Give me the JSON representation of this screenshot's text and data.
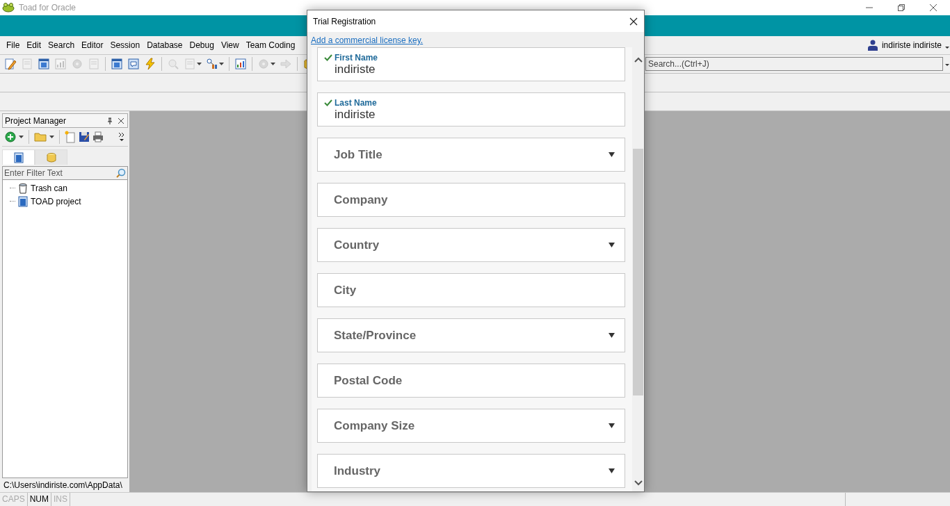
{
  "window": {
    "title": "Toad for Oracle"
  },
  "menu": [
    "File",
    "Edit",
    "Search",
    "Editor",
    "Session",
    "Database",
    "Debug",
    "View",
    "Team Coding"
  ],
  "user": {
    "name": "indiriste indiriste"
  },
  "toolbar": [
    {
      "kind": "pencil",
      "disabled": false,
      "dropdown": false
    },
    {
      "kind": "page",
      "disabled": true,
      "dropdown": false
    },
    {
      "kind": "window",
      "disabled": false,
      "dropdown": false
    },
    {
      "kind": "chart",
      "disabled": true,
      "dropdown": false
    },
    {
      "kind": "gear",
      "disabled": true,
      "dropdown": false
    },
    {
      "kind": "page",
      "disabled": true,
      "dropdown": false
    },
    {
      "kind": "separator"
    },
    {
      "kind": "window",
      "disabled": false,
      "dropdown": false
    },
    {
      "kind": "chat",
      "disabled": false,
      "dropdown": false
    },
    {
      "kind": "bolt",
      "disabled": false,
      "dropdown": false
    },
    {
      "kind": "separator"
    },
    {
      "kind": "magnifier",
      "disabled": true,
      "dropdown": false
    },
    {
      "kind": "page",
      "disabled": true,
      "dropdown": true
    },
    {
      "kind": "network",
      "disabled": false,
      "dropdown": true
    },
    {
      "kind": "separator"
    },
    {
      "kind": "chart",
      "disabled": false,
      "dropdown": false
    },
    {
      "kind": "separator"
    },
    {
      "kind": "gear",
      "disabled": true,
      "dropdown": true
    },
    {
      "kind": "arrow",
      "disabled": true,
      "dropdown": false
    },
    {
      "kind": "separator"
    },
    {
      "kind": "database",
      "disabled": false,
      "dropdown": false
    }
  ],
  "search": {
    "placeholder": "Search...(Ctrl+J)"
  },
  "project_manager": {
    "title": "Project Manager",
    "tabs": [
      {
        "kind": "project",
        "selected": true
      },
      {
        "kind": "database",
        "selected": false
      }
    ],
    "filter": {
      "placeholder": "Enter Filter Text"
    },
    "tree": [
      {
        "label": "Trash can",
        "kind": "trash"
      },
      {
        "label": "TOAD project",
        "kind": "project"
      }
    ],
    "path": "C:\\Users\\indiriste.com\\AppData\\"
  },
  "status_bar": [
    {
      "label": "CAPS",
      "on": false
    },
    {
      "label": "NUM",
      "on": true
    },
    {
      "label": "INS",
      "on": false
    }
  ],
  "dialog": {
    "title": "Trial Registration",
    "link": "Add a commercial license key.",
    "fields": [
      {
        "label": "First Name",
        "value": "indiriste",
        "kind": "text",
        "valid": true
      },
      {
        "label": "Last Name",
        "value": "indiriste",
        "kind": "text",
        "valid": true
      },
      {
        "label": "Job Title",
        "kind": "dropdown",
        "valid": false
      },
      {
        "label": "Company",
        "kind": "text",
        "valid": false
      },
      {
        "label": "Country",
        "kind": "dropdown",
        "valid": false
      },
      {
        "label": "City",
        "kind": "text",
        "valid": false
      },
      {
        "label": "State/Province",
        "kind": "dropdown",
        "valid": false
      },
      {
        "label": "Postal Code",
        "kind": "text",
        "valid": false
      },
      {
        "label": "Company Size",
        "kind": "dropdown",
        "valid": false
      },
      {
        "label": "Industry",
        "kind": "dropdown",
        "valid": false
      }
    ]
  }
}
